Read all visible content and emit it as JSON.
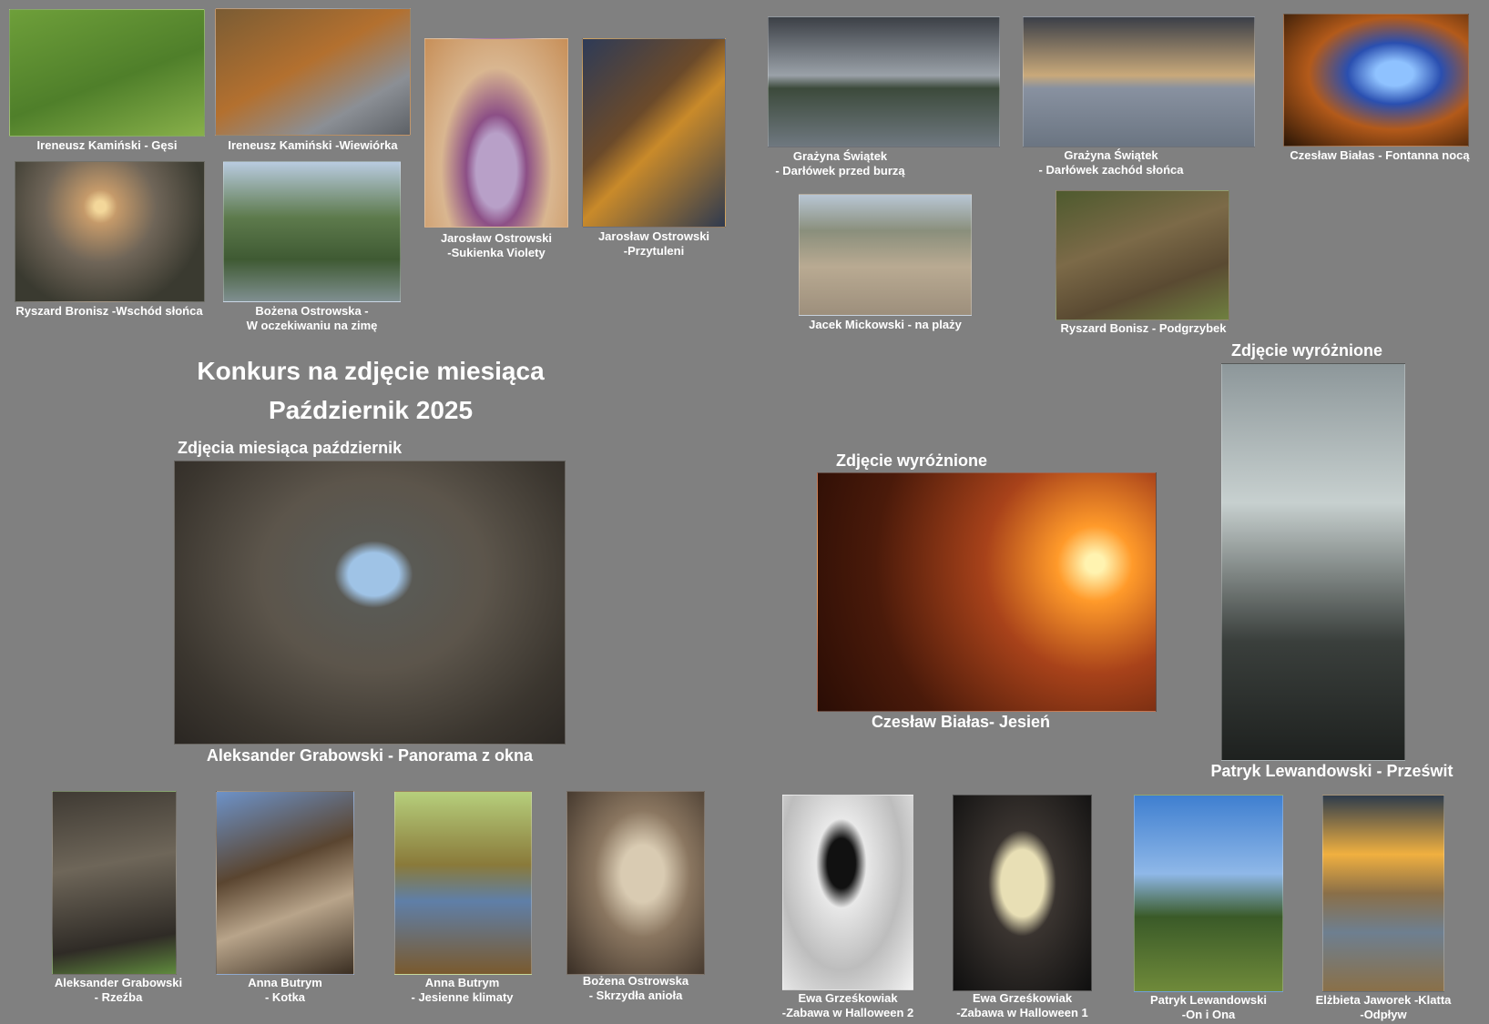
{
  "title": {
    "line1": "Konkurs na zdjęcie miesiąca",
    "line2": "Październik 2025"
  },
  "headings": {
    "main_winner": "Zdjęcia miesiąca październik",
    "distinction_1": "Zdjęcie wyróżnione",
    "distinction_2": "Zdjęcie wyróżnione"
  },
  "photos": {
    "gesi": {
      "caption": "Ireneusz Kamiński - Gęsi"
    },
    "wiewiorka": {
      "caption": "Ireneusz Kamiński -Wiewiórka"
    },
    "wschod": {
      "caption": "Ryszard Bronisz -Wschód słońca"
    },
    "zima": {
      "line1": "Bożena Ostrowska -",
      "line2": "W oczekiwaniu na zimę"
    },
    "sukienka": {
      "line1": "Jarosław Ostrowski",
      "line2": "-Sukienka Violety"
    },
    "przytuleni": {
      "line1": "Jarosław Ostrowski",
      "line2": "-Przytuleni"
    },
    "darlowek_burza": {
      "line1": "Grażyna Świątek",
      "line2": "- Darłówek przed burzą"
    },
    "darlowek_zachod": {
      "line1": "Grażyna Świątek",
      "line2": "- Darłówek zachód słońca"
    },
    "fontanna": {
      "caption": "Czesław Białas - Fontanna nocą"
    },
    "plaza": {
      "caption": "Jacek Mickowski - na plaży"
    },
    "podgrzybek": {
      "caption": "Ryszard Bonisz - Podgrzybek"
    },
    "panorama": {
      "caption": "Aleksander Grabowski - Panorama z okna"
    },
    "jesien": {
      "caption": "Czesław Białas- Jesień"
    },
    "przeswit": {
      "caption": "Patryk Lewandowski - Prześwit"
    },
    "rzezba": {
      "line1": "Aleksander Grabowski",
      "line2": "- Rzeźba"
    },
    "kotka": {
      "line1": "Anna Butrym",
      "line2": "- Kotka"
    },
    "klimaty": {
      "line1": "Anna Butrym",
      "line2": "- Jesienne klimaty"
    },
    "aniol": {
      "line1": "Bożena Ostrowska",
      "line2": "- Skrzydła anioła"
    },
    "halloween2": {
      "line1": "Ewa Grześkowiak",
      "line2": "-Zabawa w Halloween 2"
    },
    "halloween1": {
      "line1": "Ewa Grześkowiak",
      "line2": "-Zabawa w Halloween 1"
    },
    "on_ona": {
      "line1": "Patryk Lewandowski",
      "line2": "-On i Ona"
    },
    "odplyw": {
      "line1": "Elżbieta Jaworek -Klatta",
      "line2": "-Odpływ"
    }
  }
}
